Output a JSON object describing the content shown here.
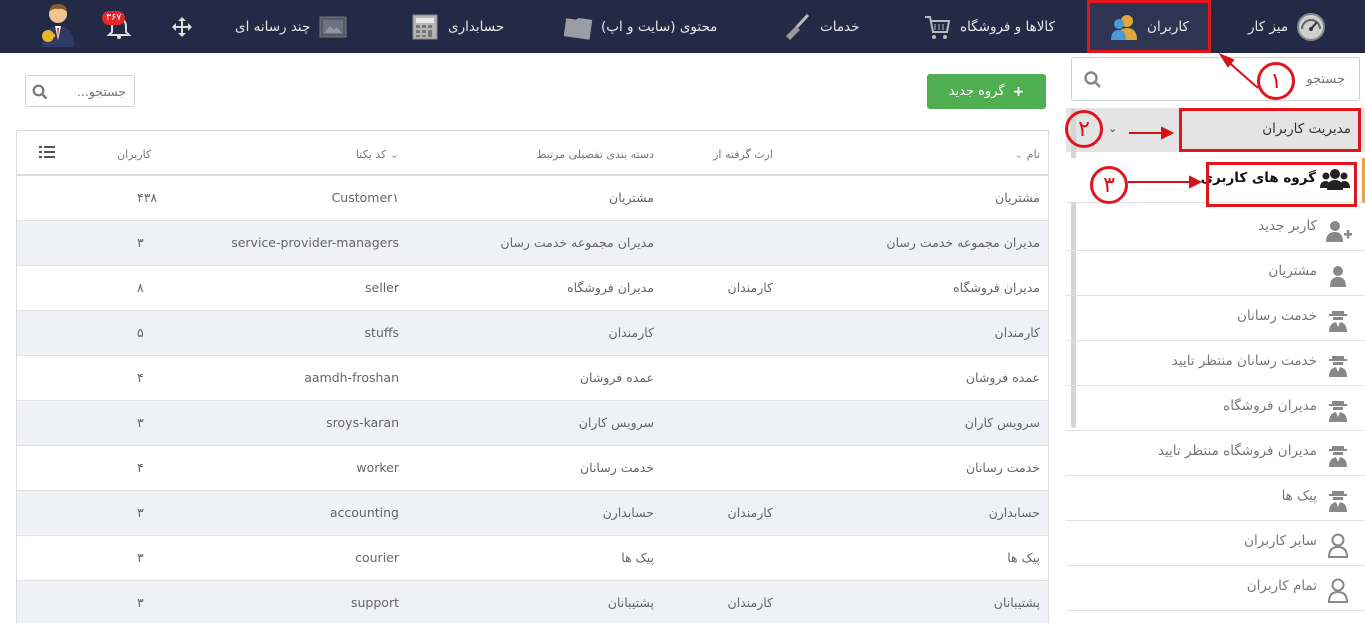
{
  "topbar": {
    "items": [
      {
        "label": "میز کار",
        "icon": "dashboard-gauge-icon"
      },
      {
        "label": "کاربران",
        "icon": "users-icon"
      },
      {
        "label": "کالاها و فروشگاه",
        "icon": "shopping-cart-icon"
      },
      {
        "label": "خدمات",
        "icon": "broom-icon"
      },
      {
        "label": "محتوی (سایت و اپ)",
        "icon": "folder-icon"
      },
      {
        "label": "حسابداری",
        "icon": "calculator-icon"
      },
      {
        "label": "چند رسانه ای",
        "icon": "media-icon"
      }
    ],
    "notification_count": "۳۶۷",
    "notification_icon": "bell-icon",
    "move_icon": "move-arrows-icon",
    "avatar_icon": "user-avatar-icon"
  },
  "sidebar": {
    "search_placeholder": "جستجو",
    "section_title": "مدیریت کاربران",
    "items": [
      {
        "label": "گروه های کاربری",
        "icon": "user-groups-icon",
        "active": true
      },
      {
        "label": "کاربر جدید",
        "icon": "add-user-icon"
      },
      {
        "label": "مشتریان",
        "icon": "user-icon"
      },
      {
        "label": "خدمت رسانان",
        "icon": "agent-icon"
      },
      {
        "label": "خدمت رسانان منتظر تایید",
        "icon": "agent-icon"
      },
      {
        "label": "مدیران فروشگاه",
        "icon": "agent-icon"
      },
      {
        "label": "مدیران فروشگاه منتظر تایید",
        "icon": "agent-icon"
      },
      {
        "label": "پیک ها",
        "icon": "agent-icon"
      },
      {
        "label": "سایر کاربران",
        "icon": "user-outline-icon"
      },
      {
        "label": "تمام کاربران",
        "icon": "user-outline-icon"
      }
    ]
  },
  "main": {
    "new_group_button": "گروه جدید",
    "search_placeholder": "جستجو...",
    "table": {
      "headers": {
        "name": "نام",
        "inherited_from": "ارث گرفته از",
        "category": "دسته بندی تفصیلی مرتبط",
        "slug": "کد یکتا",
        "users": "کاربران"
      },
      "rows": [
        {
          "name": "مشتریان",
          "inherited_from": "",
          "category": "مشتریان",
          "slug": "Customer۱",
          "users": "۴۳۸"
        },
        {
          "name": "مدیران مجموعه خدمت رسان",
          "inherited_from": "",
          "category": "مدیران مجموعه خدمت رسان",
          "slug": "service-provider-managers",
          "users": "۳"
        },
        {
          "name": "مدیران فروشگاه",
          "inherited_from": "کارمندان",
          "category": "مدیران فروشگاه",
          "slug": "seller",
          "users": "۸"
        },
        {
          "name": "کارمندان",
          "inherited_from": "",
          "category": "کارمندان",
          "slug": "stuffs",
          "users": "۵"
        },
        {
          "name": "عمده فروشان",
          "inherited_from": "",
          "category": "عمده فروشان",
          "slug": "aamdh-froshan",
          "users": "۴"
        },
        {
          "name": "سرویس کاران",
          "inherited_from": "",
          "category": "سرویس کاران",
          "slug": "sroys-karan",
          "users": "۳"
        },
        {
          "name": "خدمت رسانان",
          "inherited_from": "",
          "category": "خدمت رسانان",
          "slug": "worker",
          "users": "۴"
        },
        {
          "name": "حسابدارن",
          "inherited_from": "کارمندان",
          "category": "حسابدارن",
          "slug": "accounting",
          "users": "۳"
        },
        {
          "name": "پیک ها",
          "inherited_from": "",
          "category": "پیک ها",
          "slug": "courier",
          "users": "۳"
        },
        {
          "name": "پشتیبانان",
          "inherited_from": "کارمندان",
          "category": "پشتیبانان",
          "slug": "support",
          "users": "۳"
        }
      ]
    }
  },
  "annotations": [
    "۱",
    "۲",
    "۳"
  ],
  "colors": {
    "topbar_bg": "#232a45",
    "accent_green": "#4fae4f",
    "annotation_red": "#e0161c",
    "active_marker": "#e8a14c"
  }
}
